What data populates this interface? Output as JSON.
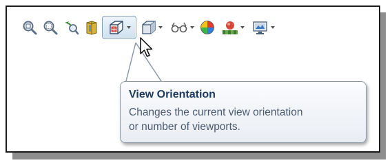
{
  "toolbar": {
    "buttons": [
      {
        "icon": "zoom-to-fit-icon",
        "has_dropdown": false
      },
      {
        "icon": "zoom-to-area-icon",
        "has_dropdown": false
      },
      {
        "icon": "previous-view-icon",
        "has_dropdown": false
      },
      {
        "icon": "section-view-icon",
        "has_dropdown": false
      },
      {
        "icon": "view-orientation-icon",
        "has_dropdown": true,
        "active": true
      },
      {
        "icon": "display-style-icon",
        "has_dropdown": true
      },
      {
        "icon": "hide-show-items-icon",
        "has_dropdown": true
      },
      {
        "icon": "edit-appearance-icon",
        "has_dropdown": false
      },
      {
        "icon": "apply-scene-icon",
        "has_dropdown": true
      },
      {
        "icon": "view-settings-icon",
        "has_dropdown": true
      }
    ]
  },
  "tooltip": {
    "title": "View Orientation",
    "description": "Changes the current view orientation\nor number of viewports."
  },
  "colors": {
    "tooltip_title": "#1e3c60",
    "tooltip_text": "#4a5a6e",
    "active_button_border": "#7d9bb8"
  }
}
